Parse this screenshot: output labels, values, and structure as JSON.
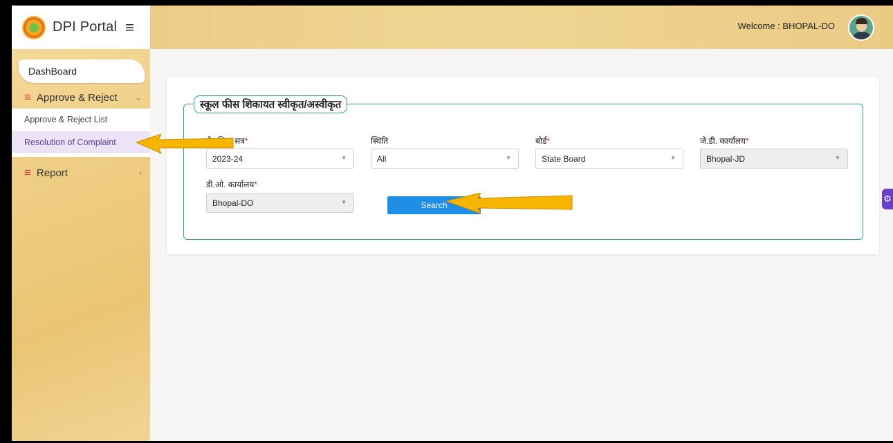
{
  "brand": {
    "title": "DPI Portal"
  },
  "topbar": {
    "welcome": "Welcome : BHOPAL-DO"
  },
  "sidebar": {
    "dashboard": "DashBoard",
    "approve_reject": "Approve & Reject",
    "items": [
      "Approve & Reject List",
      "Resolution of Complaint"
    ],
    "report": "Report"
  },
  "form": {
    "legend": "स्कूल फीस शिकायत स्वीकृत/अस्वीकृत",
    "fields": [
      {
        "label": "शैक्षणिक सत्र",
        "required": "*",
        "value": "2023-24"
      },
      {
        "label": "स्थिति",
        "required": "",
        "value": "All"
      },
      {
        "label": "बोर्ड",
        "required": "*",
        "value": "State Board"
      },
      {
        "label": "जे.डी. कार्यालय",
        "required": "*",
        "value": "Bhopal-JD"
      },
      {
        "label": "डी.ओ. कार्यालय",
        "required": "*",
        "value": "Bhopal-DO"
      }
    ],
    "search_label": "Search"
  },
  "colors": {
    "accent": "#1f8ee6",
    "fieldset_border": "#2e9ea2",
    "annotation_arrow": "#f7b500"
  }
}
